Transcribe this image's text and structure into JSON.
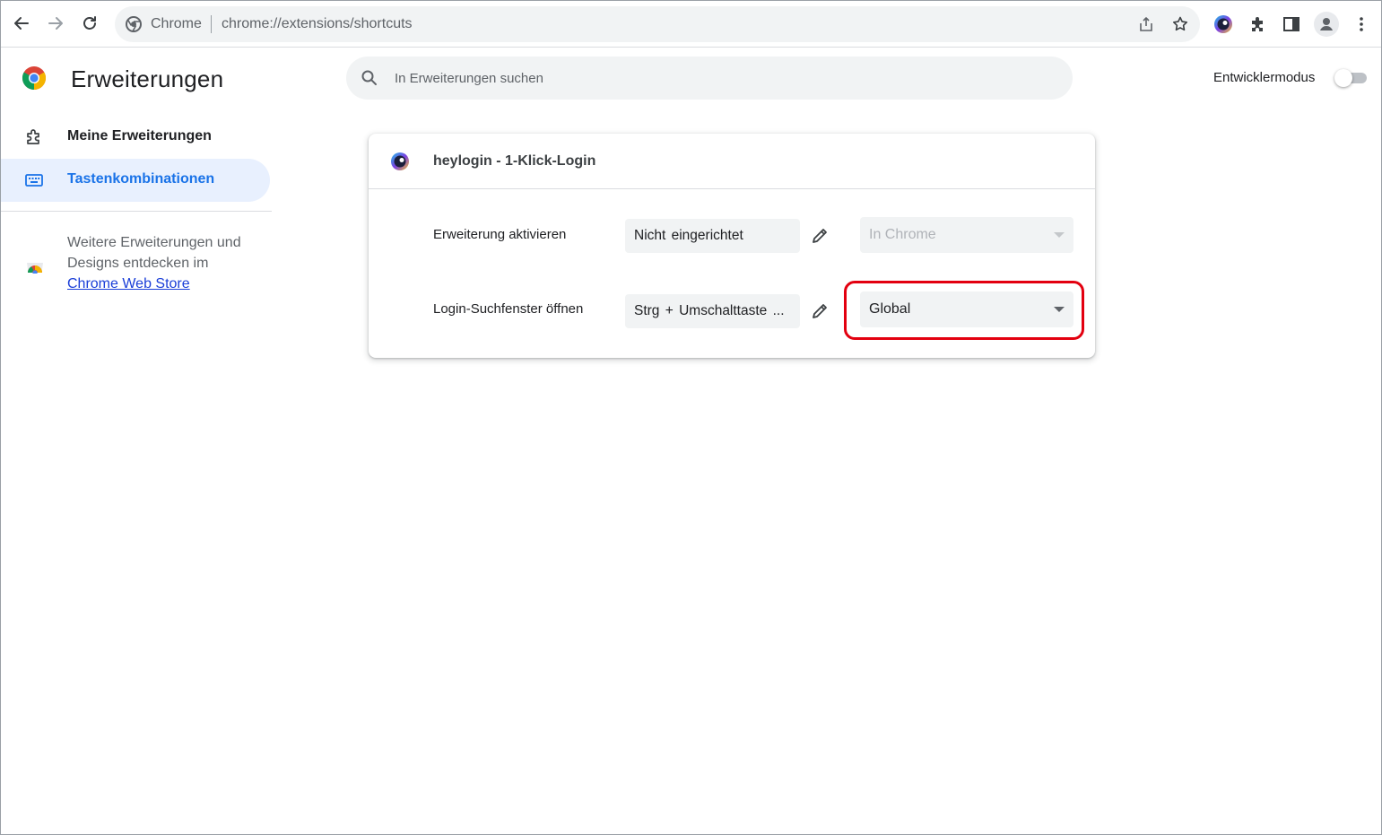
{
  "browser": {
    "site_label": "Chrome",
    "url_host": "chrome://",
    "url_path": "extensions/shortcuts"
  },
  "sidebar": {
    "title": "Erweiterungen",
    "items": [
      {
        "label": "Meine Erweiterungen",
        "icon": "puzzle-icon",
        "active": false
      },
      {
        "label": "Tastenkombinationen",
        "icon": "keyboard-icon",
        "active": true
      }
    ],
    "webstore_text": "Weitere Erweiterungen und Designs entdecken im",
    "webstore_link": "Chrome Web Store"
  },
  "search": {
    "placeholder": "In Erweiterungen suchen"
  },
  "devmode": {
    "label": "Entwicklermodus",
    "enabled": false
  },
  "extension": {
    "name": "heylogin - 1-Klick-Login",
    "commands": [
      {
        "label": "Erweiterung aktivieren",
        "shortcut": "Nicht eingerichtet",
        "scope": "In Chrome",
        "scope_disabled": true
      },
      {
        "label": "Login-Suchfenster öffnen",
        "shortcut": "Strg + Umschalttaste ...",
        "scope": "Global",
        "scope_disabled": false
      }
    ]
  },
  "colors": {
    "accent": "#1a73e8",
    "highlight": "#e3000f"
  }
}
